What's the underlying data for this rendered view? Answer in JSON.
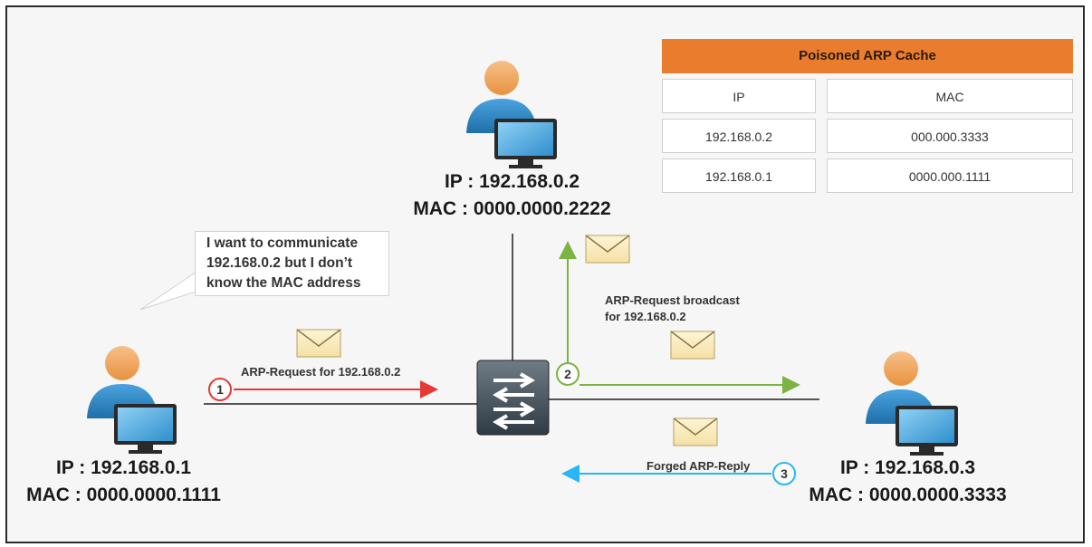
{
  "table": {
    "title": "Poisoned ARP Cache",
    "columns": [
      "IP",
      "MAC"
    ],
    "rows": [
      {
        "ip": "192.168.0.2",
        "mac": "000.000.3333"
      },
      {
        "ip": "192.168.0.1",
        "mac": "0000.000.1111"
      }
    ]
  },
  "hosts": {
    "host1": {
      "ip": "IP : 192.168.0.1",
      "mac": "MAC : 0000.0000.1111"
    },
    "host2": {
      "ip": "IP : 192.168.0.2",
      "mac": "MAC : 0000.0000.2222"
    },
    "host3": {
      "ip": "IP : 192.168.0.3",
      "mac": "MAC : 0000.0000.3333"
    }
  },
  "callout": {
    "lines": [
      "I want to communicate",
      "192.168.0.2 but I don’t",
      "know the MAC address"
    ]
  },
  "steps": {
    "step1": {
      "number": "1",
      "label": "ARP-Request for 192.168.0.2",
      "color": "#e53935"
    },
    "step2": {
      "number": "2",
      "label_lines": [
        "ARP-Request broadcast",
        "for 192.168.0.2"
      ],
      "color": "#7cb342"
    },
    "step3": {
      "number": "3",
      "label": "Forged ARP-Reply",
      "color": "#29b6f6"
    }
  },
  "icons": [
    "user-icon",
    "monitor-icon",
    "switch-icon",
    "envelope-icon"
  ],
  "colors": {
    "table_header": "#ea7d2d",
    "person_head": "#f4a460",
    "person_body": "#2e86c1",
    "monitor": "#3a9fd6",
    "switch": "#3d4a55"
  }
}
